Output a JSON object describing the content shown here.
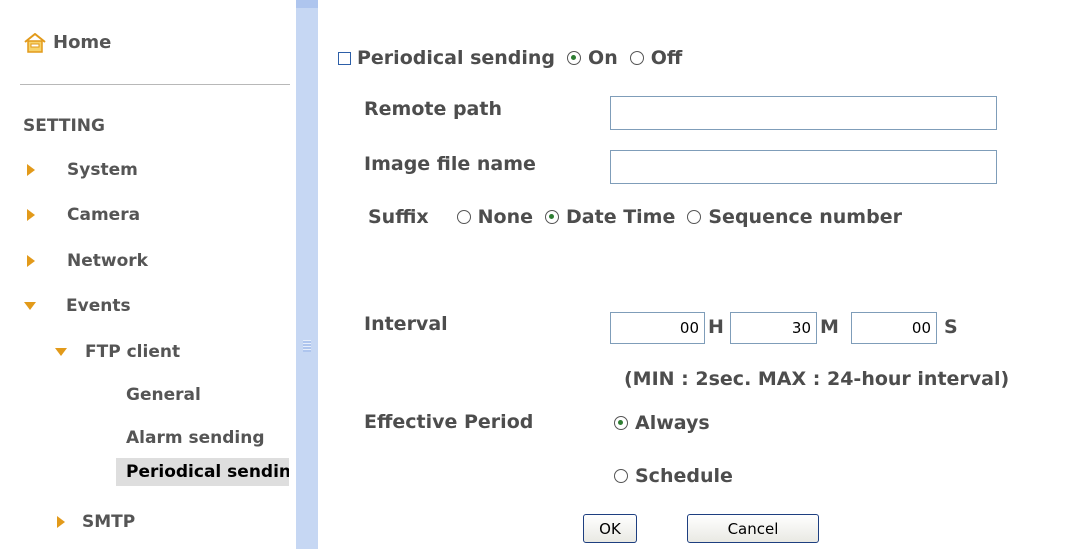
{
  "sidebar": {
    "home_label": "Home",
    "section_label": "SETTING",
    "items": [
      {
        "label": "System"
      },
      {
        "label": "Camera"
      },
      {
        "label": "Network"
      },
      {
        "label": "Events"
      }
    ],
    "ftp": {
      "label": "FTP client",
      "subitems": [
        "General",
        "Alarm sending",
        "Periodical sending"
      ]
    },
    "smtp_label": "SMTP"
  },
  "form": {
    "periodical_label": "Periodical sending",
    "on_label": "On",
    "off_label": "Off",
    "periodical_state": "On",
    "remote_path_label": "Remote path",
    "remote_path_value": "",
    "image_name_label": "Image file name",
    "image_name_value": "",
    "suffix_label": "Suffix",
    "suffix_options": [
      "None",
      "Date Time",
      "Sequence number"
    ],
    "suffix_selected": "Date Time",
    "interval_label": "Interval",
    "interval_h": "00",
    "interval_m": "30",
    "interval_s": "00",
    "unit_h": "H",
    "unit_m": "M",
    "unit_s": "S",
    "interval_note": "(MIN : 2sec. MAX : 24-hour interval)",
    "effective_label": "Effective Period",
    "always_label": "Always",
    "schedule_label": "Schedule",
    "effective_selected": "Always",
    "ok_label": "OK",
    "cancel_label": "Cancel"
  }
}
